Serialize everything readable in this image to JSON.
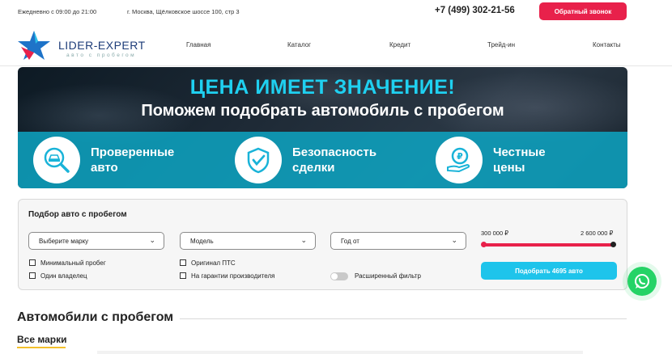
{
  "topbar": {
    "hours": "Ежедневно с 09:00 до 21:00",
    "address": "г. Москва, Щёлковское шоссе 100, стр 3",
    "phone": "+7 (499) 302-21-56",
    "callback_label": "Обратный звонок"
  },
  "logo": {
    "brand": "LIDER-EXPERT",
    "tagline": "авто с пробегом"
  },
  "nav": {
    "items": [
      {
        "label": "Главная"
      },
      {
        "label": "Каталог"
      },
      {
        "label": "Кредит"
      },
      {
        "label": "Трейд-ин"
      },
      {
        "label": "Контакты"
      }
    ]
  },
  "hero": {
    "headline": "ЦЕНА ИМЕЕТ ЗНАЧЕНИЕ!",
    "subheadline": "Поможем подобрать автомобиль с пробегом",
    "features": [
      {
        "line1": "Проверенные",
        "line2": "авто",
        "icon": "car-magnifier-icon"
      },
      {
        "line1": "Безопасность",
        "line2": "сделки",
        "icon": "shield-check-icon"
      },
      {
        "line1": "Честные",
        "line2": "цены",
        "icon": "ruble-hand-icon"
      }
    ]
  },
  "filter": {
    "title": "Подбор авто с пробегом",
    "brand_select": "Выберите марку",
    "model_select": "Модель",
    "year_select": "Год от",
    "checkboxes": [
      {
        "label": "Минимальный пробег",
        "checked": false
      },
      {
        "label": "Один владелец",
        "checked": false
      },
      {
        "label": "Оригинал ПТС",
        "checked": false
      },
      {
        "label": "На гарантии производителя",
        "checked": false
      }
    ],
    "advanced_toggle": "Расширенный фильтр",
    "advanced_on": false,
    "price_min": "300 000 ₽",
    "price_max": "2 600 000 ₽",
    "submit_label": "Подобрать 4695 авто"
  },
  "section": {
    "title": "Автомобили с пробегом",
    "brands_tab": "Все марки"
  },
  "colors": {
    "accent_red": "#e8214b",
    "accent_cyan": "#1ec4eb",
    "whatsapp": "#25d366"
  }
}
